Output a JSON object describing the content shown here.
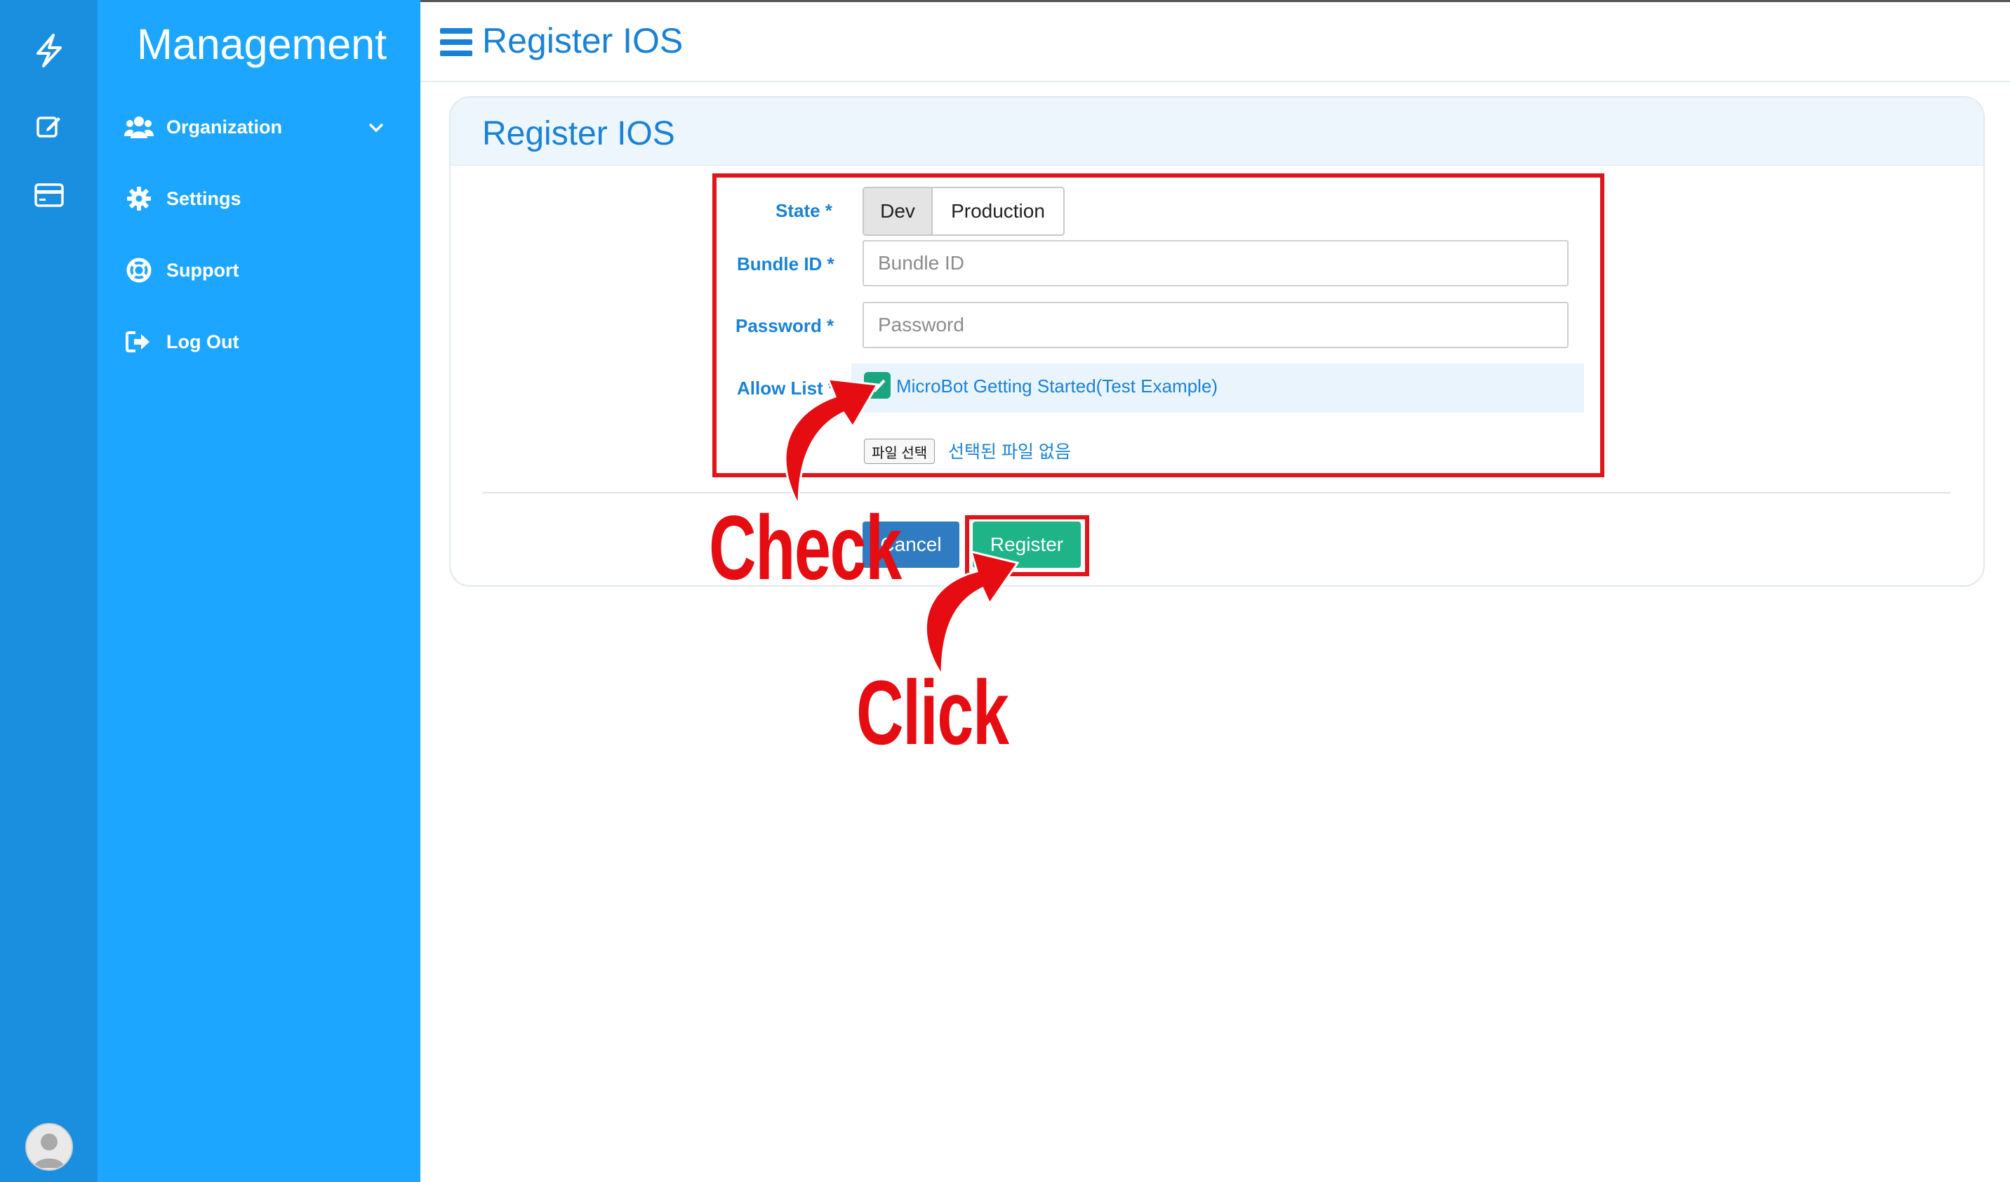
{
  "sidebar": {
    "brand": "Management",
    "items": [
      {
        "label": "Organization",
        "icon": "users-icon"
      },
      {
        "label": "Settings",
        "icon": "gear-icon"
      },
      {
        "label": "Support",
        "icon": "lifebuoy-icon"
      },
      {
        "label": "Log Out",
        "icon": "logout-icon"
      }
    ]
  },
  "header": {
    "title": "Register IOS"
  },
  "card": {
    "title": "Register IOS"
  },
  "form": {
    "state_label": "State *",
    "state_options": [
      "Dev",
      "Production"
    ],
    "state_selected": "Dev",
    "bundle_label": "Bundle ID *",
    "bundle_placeholder": "Bundle ID",
    "password_label": "Password *",
    "password_placeholder": "Password",
    "allow_label": "Allow List *",
    "allow_item": "MicroBot Getting Started(Test Example)",
    "allow_checked": true,
    "file_button": "파일 선택",
    "file_status": "선택된 파일 없음"
  },
  "actions": {
    "cancel": "Cancel",
    "register": "Register"
  },
  "annotations": {
    "check": "Check",
    "click": "Click"
  },
  "colors": {
    "sidebar": "#1da6ff",
    "rail": "#1a8fdf",
    "accent": "#1a82d6",
    "register": "#1fb487",
    "cancel": "#2f7cc2",
    "highlight": "#e0141b"
  }
}
